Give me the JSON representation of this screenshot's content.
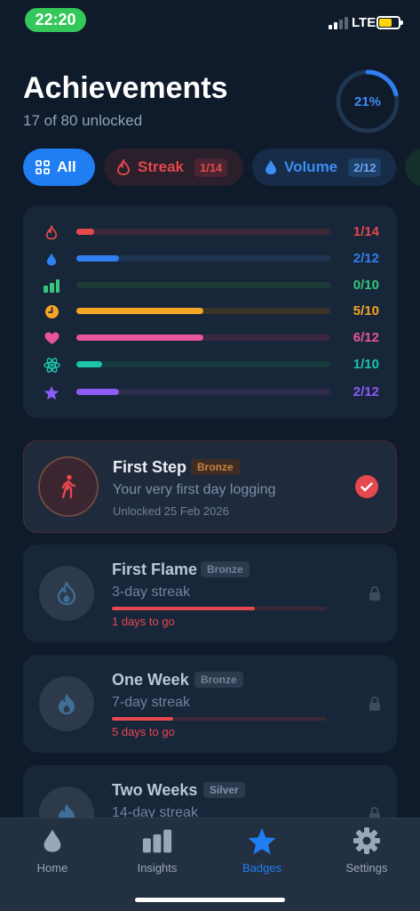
{
  "status_bar": {
    "time": "22:20",
    "network": "LTE"
  },
  "header": {
    "title": "Achievements",
    "subtitle": "17 of 80 unlocked",
    "progress_label": "21%",
    "progress_value": 0.21
  },
  "filters": [
    {
      "label": "All",
      "count": "",
      "icon": "grid-icon",
      "active": true
    },
    {
      "label": "Streak",
      "count": "1/14",
      "icon": "flame-icon"
    },
    {
      "label": "Volume",
      "count": "2/12",
      "icon": "drop-icon"
    }
  ],
  "summary": [
    {
      "category": "streak",
      "icon": "flame-icon",
      "value": "1/14",
      "progress": 0.0714,
      "color": "#e5484d",
      "track": "#3a2836"
    },
    {
      "category": "volume",
      "icon": "drop-icon",
      "value": "2/12",
      "progress": 0.1667,
      "color": "#2f7ff0",
      "track": "#1e3450"
    },
    {
      "category": "consistency",
      "icon": "bar-chart-icon",
      "value": "0/10",
      "progress": 0.0,
      "color": "#34c77b",
      "track": "#1c3a36"
    },
    {
      "category": "timing",
      "icon": "clock-icon",
      "value": "5/10",
      "progress": 0.5,
      "color": "#f5a524",
      "track": "#3a3428"
    },
    {
      "category": "health",
      "icon": "heart-icon",
      "value": "6/12",
      "progress": 0.5,
      "color": "#e7559a",
      "track": "#3a2840"
    },
    {
      "category": "science",
      "icon": "atom-icon",
      "value": "1/10",
      "progress": 0.1,
      "color": "#1cc4a8",
      "track": "#163a3c"
    },
    {
      "category": "special",
      "icon": "star-icon",
      "value": "2/12",
      "progress": 0.1667,
      "color": "#8b5cf6",
      "track": "#2c2a48"
    }
  ],
  "badges": [
    {
      "name": "First Step",
      "tier": "Bronze",
      "desc": "Your very first day logging",
      "date": "Unlocked 25 Feb 2026",
      "unlocked": true
    },
    {
      "name": "First Flame",
      "tier": "Bronze",
      "desc": "3-day streak",
      "togo": "1 days to go",
      "progress": 0.667,
      "unlocked": false
    },
    {
      "name": "One Week",
      "tier": "Bronze",
      "desc": "7-day streak",
      "togo": "5 days to go",
      "progress": 0.286,
      "unlocked": false
    },
    {
      "name": "Two Weeks",
      "tier": "Silver",
      "desc": "14-day streak",
      "unlocked": false
    }
  ],
  "tabs": [
    {
      "label": "Home",
      "icon": "drop-icon"
    },
    {
      "label": "Insights",
      "icon": "bar-chart-icon"
    },
    {
      "label": "Badges",
      "icon": "star-icon",
      "active": true
    },
    {
      "label": "Settings",
      "icon": "gear-icon"
    }
  ]
}
